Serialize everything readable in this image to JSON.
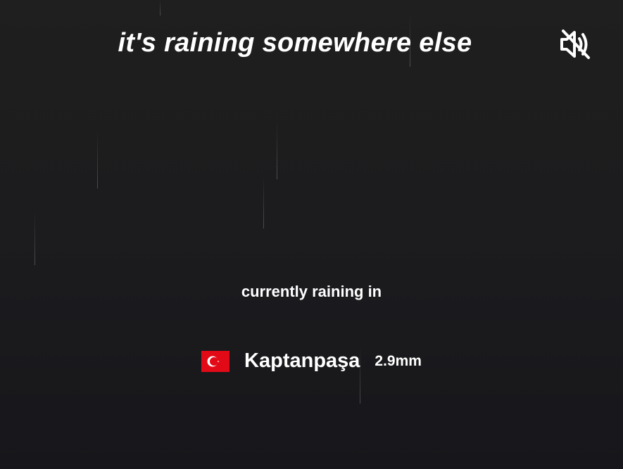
{
  "header": {
    "title": "it's raining somewhere else",
    "mute_icon": "speaker-muted-icon"
  },
  "main": {
    "subtitle": "currently raining in",
    "location": {
      "flag_icon": "turkey-flag-icon",
      "city": "Kaptanpaşa",
      "precipitation": "2.9mm"
    }
  },
  "colors": {
    "background_top": "#1f1f1f",
    "background_bottom": "#17171b",
    "text": "#ffffff",
    "flag_red": "#e30a17"
  }
}
